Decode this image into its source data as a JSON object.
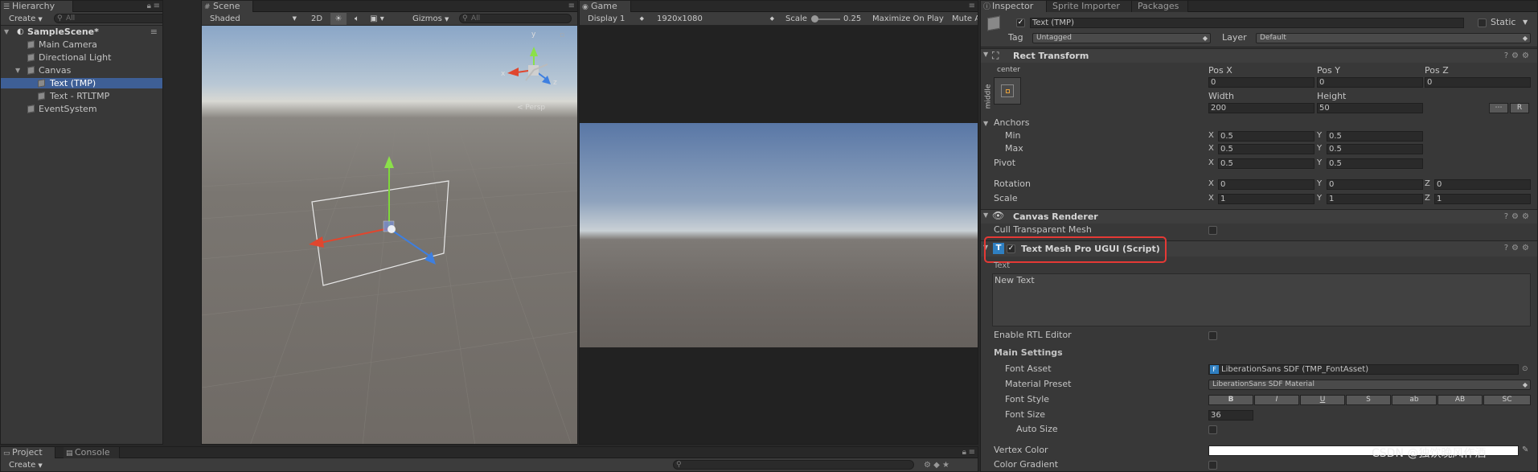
{
  "hierarchy": {
    "tab": "Hierarchy",
    "create_label": "Create",
    "search_placeholder": "All",
    "scene_name": "SampleScene*",
    "items": [
      {
        "label": "Main Camera"
      },
      {
        "label": "Directional Light"
      },
      {
        "label": "Canvas"
      },
      {
        "label": "Text (TMP)"
      },
      {
        "label": "Text - RTLTMP"
      },
      {
        "label": "EventSystem"
      }
    ]
  },
  "scene": {
    "tab": "Scene",
    "shading_mode": "Shaded",
    "mode_2d": "2D",
    "gizmos_label": "Gizmos",
    "search_placeholder": "All",
    "axis_labels": {
      "y": "y",
      "x": "x",
      "z": "z"
    },
    "view_label": "< Persp"
  },
  "game": {
    "tab": "Game",
    "display": "Display 1",
    "resolution": "1920x1080",
    "scale_label": "Scale",
    "scale_value": "0.25",
    "maximize_label": "Maximize On Play",
    "mute_label": "Mute A"
  },
  "inspector": {
    "tabs": [
      {
        "label": "Inspector"
      },
      {
        "label": "Sprite Importer"
      },
      {
        "label": "Packages"
      }
    ],
    "object_name": "Text (TMP)",
    "active_checked": true,
    "static_label": "Static",
    "tag_label": "Tag",
    "tag_value": "Untagged",
    "layer_label": "Layer",
    "layer_value": "Default",
    "rect_transform": {
      "title": "Rect Transform",
      "anchor_h": "center",
      "anchor_v": "middle",
      "pos_x_label": "Pos X",
      "pos_y_label": "Pos Y",
      "pos_z_label": "Pos Z",
      "pos_x": "0",
      "pos_y": "0",
      "pos_z": "0",
      "width_label": "Width",
      "height_label": "Height",
      "width": "200",
      "height": "50",
      "r_button": "R",
      "anchors_label": "Anchors",
      "min_label": "Min",
      "max_label": "Max",
      "min_x": "0.5",
      "min_y": "0.5",
      "max_x": "0.5",
      "max_y": "0.5",
      "pivot_label": "Pivot",
      "pivot_x": "0.5",
      "pivot_y": "0.5",
      "rotation_label": "Rotation",
      "rot_x": "0",
      "rot_y": "0",
      "rot_z": "0",
      "scale_label": "Scale",
      "scale_x": "1",
      "scale_y": "1",
      "scale_z": "1",
      "axis_x": "X",
      "axis_y": "Y",
      "axis_z": "Z"
    },
    "canvas_renderer": {
      "title": "Canvas Renderer",
      "cull_label": "Cull Transparent Mesh"
    },
    "tmp": {
      "title": "Text Mesh Pro UGUI (Script)",
      "text_label": "Text",
      "text_value": "New Text",
      "rtl_label": "Enable RTL Editor",
      "main_settings": "Main Settings",
      "font_asset_label": "Font Asset",
      "font_asset_value": "LiberationSans SDF (TMP_FontAsset)",
      "material_label": "Material Preset",
      "material_value": "LiberationSans SDF Material",
      "font_style_label": "Font Style",
      "font_styles": [
        {
          "label": "B"
        },
        {
          "label": "I"
        },
        {
          "label": "U"
        },
        {
          "label": "S"
        },
        {
          "label": "ab"
        },
        {
          "label": "AB"
        },
        {
          "label": "SC"
        }
      ],
      "font_size_label": "Font Size",
      "font_size": "36",
      "auto_size_label": "Auto Size",
      "vertex_color_label": "Vertex Color",
      "color_gradient_label": "Color Gradient",
      "highlight_color": "#e53935"
    }
  },
  "bottom": {
    "tabs": [
      {
        "label": "Project"
      },
      {
        "label": "Console"
      }
    ],
    "create_label": "Create"
  },
  "watermark": "CSDN @独饮晚风作酒"
}
